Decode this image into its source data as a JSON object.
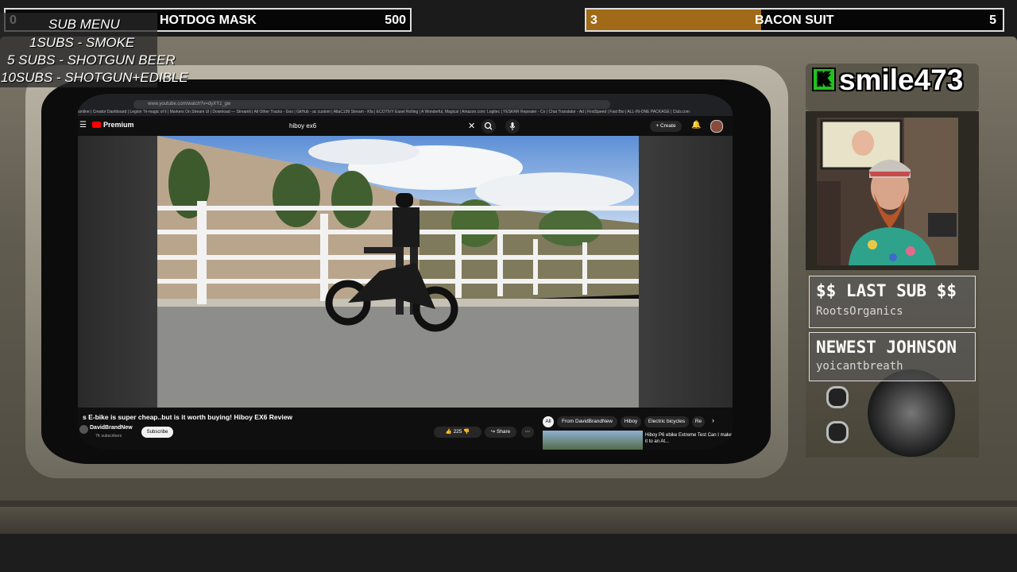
{
  "left_goal": {
    "current": "0",
    "title": "HOTDOG MASK",
    "target": "500"
  },
  "right_goal": {
    "current": "3",
    "title": "BACON SUIT",
    "target": "5",
    "progress": 0.42
  },
  "sub_menu": {
    "title": "SUB MENU",
    "items": [
      "1SUBS   - SMOKE",
      "5 SUBS  - SHOTGUN BEER",
      "10SUBS - SHOTGUN+EDIBLE"
    ]
  },
  "browser": {
    "url": "www.youtube.com/watch?v=dyXYz_gw",
    "bookmarks": "tonline | Creator Dashboard | Legion Tri-magic of li | Markers On Stream Ul | Download — Streamli | All Other Tracks - Goo | GitHub - ac custom | AltaC199 Stream - Kfa | ECOTIVY Easel Rolling | A Wonderful, Magical | Amazon.com: Logitec | YESKRR Repeater - Co | Chat Translator - Ad | FirstSpeed | Fast Bio | ALL-IN-ONE PACKAGE | Club.com"
  },
  "youtube": {
    "logo": "Premium",
    "search_value": "hiboy ex6",
    "create_label": "Create",
    "video_title": "s E-bike is super cheap..but is it worth buying! Hiboy EX6 Review",
    "channel": "DavidBrandNew",
    "subscribers": "7K subscribers",
    "subscribe_label": "Subscribe",
    "likes": "225",
    "share_label": "Share",
    "chips": [
      "All",
      "From DavidBrandNew",
      "Hiboy",
      "Electric bicycles",
      "Re"
    ],
    "rec_title": "Hiboy P6 ebike Extreme Test Can I make it to an At..."
  },
  "overlay": {
    "brand": "smile473",
    "brand_icon": "K",
    "last_sub_title": "$$ LAST SUB $$",
    "last_sub_name": "RootsOrganics",
    "newest_title": "NEWEST JOHNSON",
    "newest_name": "yoicantbreath"
  },
  "colors": {
    "goal_fill": "#a06a18",
    "kick_green": "#21c21e",
    "yt_red": "#ff0000"
  }
}
